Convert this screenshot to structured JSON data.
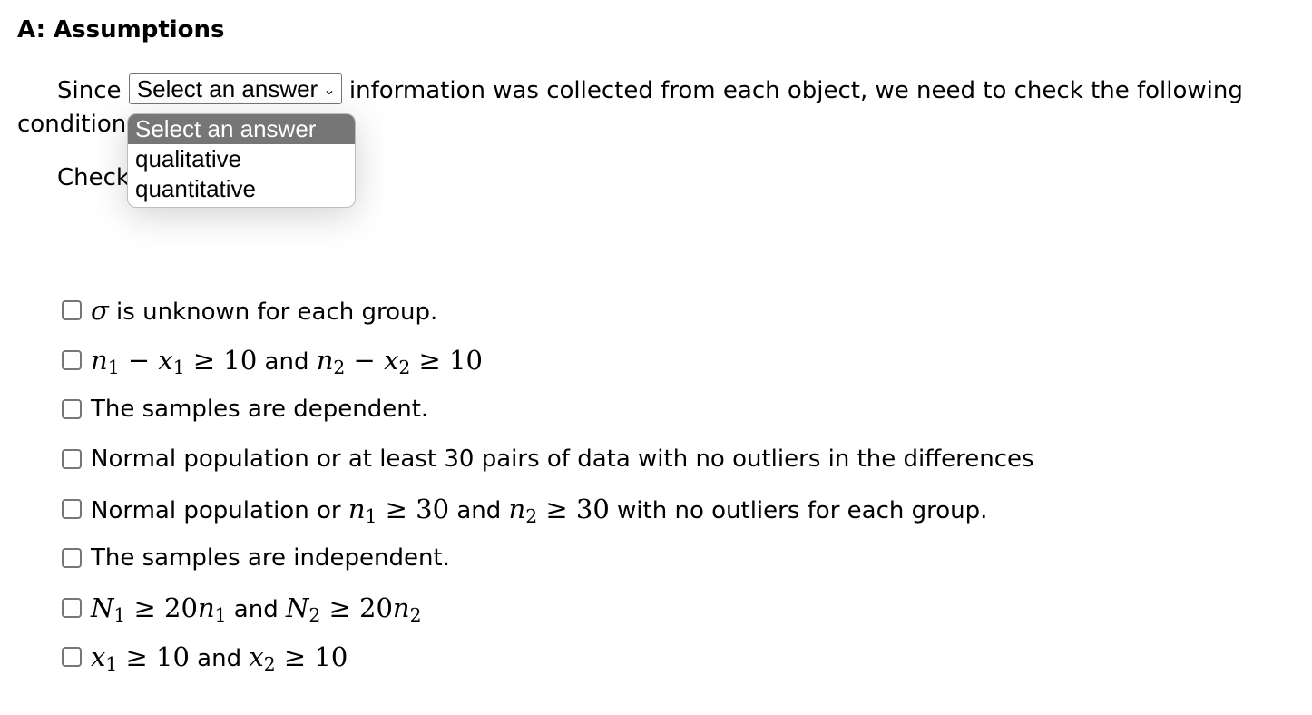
{
  "heading": "A: Assumptions",
  "paragraph": {
    "before": "Since",
    "after": "information was collected from each object, we need to check the following",
    "line2": "conditions:"
  },
  "select": {
    "value": "Select an answer",
    "options": [
      "Select an answer",
      "qualitative",
      "quantitative"
    ]
  },
  "check_line": "Check all that apply.",
  "conditions": [
    {
      "parts": [
        {
          "m": "σ"
        },
        {
          "t": " is unknown for each group."
        }
      ]
    },
    {
      "parts": [
        {
          "m": "n₁ − x₁ ≥ 10"
        },
        {
          "t": " and "
        },
        {
          "m": "n₂ − x₂ ≥ 10"
        }
      ]
    },
    {
      "parts": [
        {
          "t": "The samples are dependent."
        }
      ]
    },
    {
      "parts": [
        {
          "t": "Normal population or at least 30 pairs of data with no outliers in the differences"
        }
      ]
    },
    {
      "parts": [
        {
          "t": "Normal population or "
        },
        {
          "m": "n₁ ≥ 30"
        },
        {
          "t": " and "
        },
        {
          "m": "n₂ ≥ 30"
        },
        {
          "t": " with no outliers for each group."
        }
      ]
    },
    {
      "parts": [
        {
          "t": "The samples are independent."
        }
      ]
    },
    {
      "parts": [
        {
          "m": "N₁ ≥ 20n₁"
        },
        {
          "t": " and "
        },
        {
          "m": "N₂ ≥ 20n₂"
        }
      ]
    },
    {
      "parts": [
        {
          "m": "x₁ ≥ 10"
        },
        {
          "t": " and "
        },
        {
          "m": "x₂ ≥ 10"
        }
      ]
    }
  ]
}
